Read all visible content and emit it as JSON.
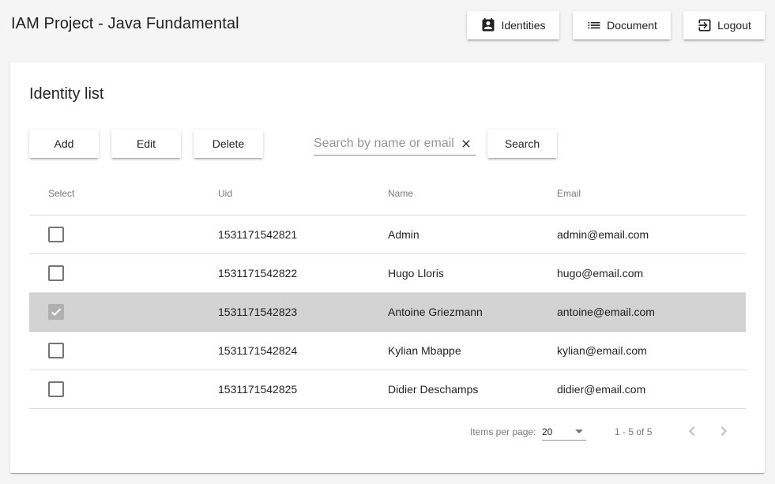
{
  "app": {
    "title": "IAM Project - Java Fundamental",
    "nav": {
      "identities_label": "Identities",
      "document_label": "Document",
      "logout_label": "Logout"
    }
  },
  "card": {
    "title": "Identity list",
    "actions": {
      "add_label": "Add",
      "edit_label": "Edit",
      "delete_label": "Delete",
      "search_label": "Search"
    },
    "search": {
      "placeholder": "Search by name or email",
      "value": ""
    }
  },
  "table": {
    "columns": [
      "Select",
      "Uid",
      "Name",
      "Email"
    ],
    "rows": [
      {
        "uid": "1531171542821",
        "name": "Admin",
        "email": "admin@email.com",
        "selected": false
      },
      {
        "uid": "1531171542822",
        "name": "Hugo Lloris",
        "email": "hugo@email.com",
        "selected": false
      },
      {
        "uid": "1531171542823",
        "name": "Antoine Griezmann",
        "email": "antoine@email.com",
        "selected": true
      },
      {
        "uid": "1531171542824",
        "name": "Kylian Mbappe",
        "email": "kylian@email.com",
        "selected": false
      },
      {
        "uid": "1531171542825",
        "name": "Didier Deschamps",
        "email": "didier@email.com",
        "selected": false
      }
    ]
  },
  "paginator": {
    "items_per_page_label": "Items per page:",
    "page_size": "20",
    "range_label": "1 - 5 of 5"
  },
  "icons": {
    "identities": "contact-card-icon",
    "document": "list-icon",
    "logout": "exit-icon",
    "clear": "close-icon",
    "prev": "chevron-left-icon",
    "next": "chevron-right-icon",
    "dropdown": "triangle-down-icon"
  },
  "colors": {
    "selected_row": "#d3d3d3",
    "toolbar_bg": "#f5f5f5",
    "checked_box": "#b0b0b0"
  }
}
